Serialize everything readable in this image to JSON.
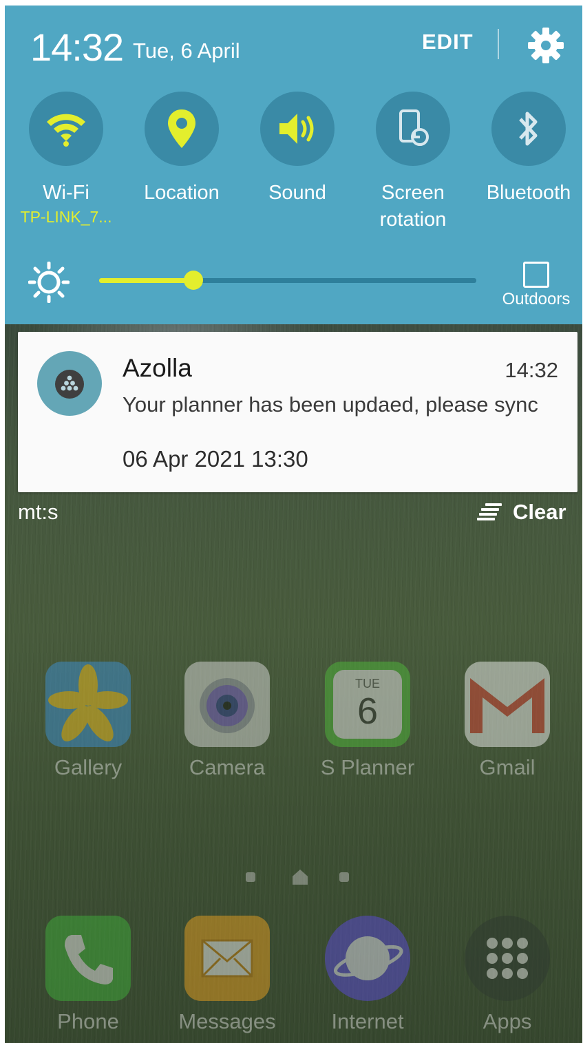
{
  "status": {
    "time": "14:32",
    "date": "Tue, 6 April"
  },
  "header": {
    "edit_label": "EDIT"
  },
  "quick_toggles": [
    {
      "label": "Wi-Fi",
      "sub": "TP-LINK_7...",
      "icon": "wifi-icon",
      "active": true
    },
    {
      "label": "Location",
      "sub": "",
      "icon": "location-pin-icon",
      "active": true
    },
    {
      "label": "Sound",
      "sub": "",
      "icon": "speaker-icon",
      "active": true
    },
    {
      "label": "Screen rotation",
      "sub": "",
      "icon": "screen-rotation-icon",
      "active": false
    },
    {
      "label": "Bluetooth",
      "sub": "",
      "icon": "bluetooth-icon",
      "active": false
    }
  ],
  "brightness": {
    "level": 0.25,
    "outdoors_label": "Outdoors",
    "outdoors_checked": false
  },
  "notification": {
    "app": "Azolla",
    "time": "14:32",
    "message": "Your planner has been updaed, please sync",
    "datetime": "06 Apr 2021 13:30"
  },
  "footer": {
    "carrier": "mt:s",
    "clear_label": "Clear"
  },
  "home_apps": [
    {
      "name": "Gallery",
      "icon": "gallery-icon"
    },
    {
      "name": "Camera",
      "icon": "camera-icon"
    },
    {
      "name": "S Planner",
      "icon": "calendar-icon",
      "day_label": "TUE",
      "day_number": "6"
    },
    {
      "name": "Gmail",
      "icon": "gmail-icon"
    }
  ],
  "dock_apps": [
    {
      "name": "Phone",
      "icon": "phone-icon"
    },
    {
      "name": "Messages",
      "icon": "messages-icon"
    },
    {
      "name": "Internet",
      "icon": "internet-icon"
    },
    {
      "name": "Apps",
      "icon": "apps-grid-icon"
    }
  ],
  "colors": {
    "panel": "#50a7c3",
    "toggle_circle": "#3a8aa6",
    "accent_yellow": "#e3ee2d",
    "notification_bg": "#fafafa"
  }
}
